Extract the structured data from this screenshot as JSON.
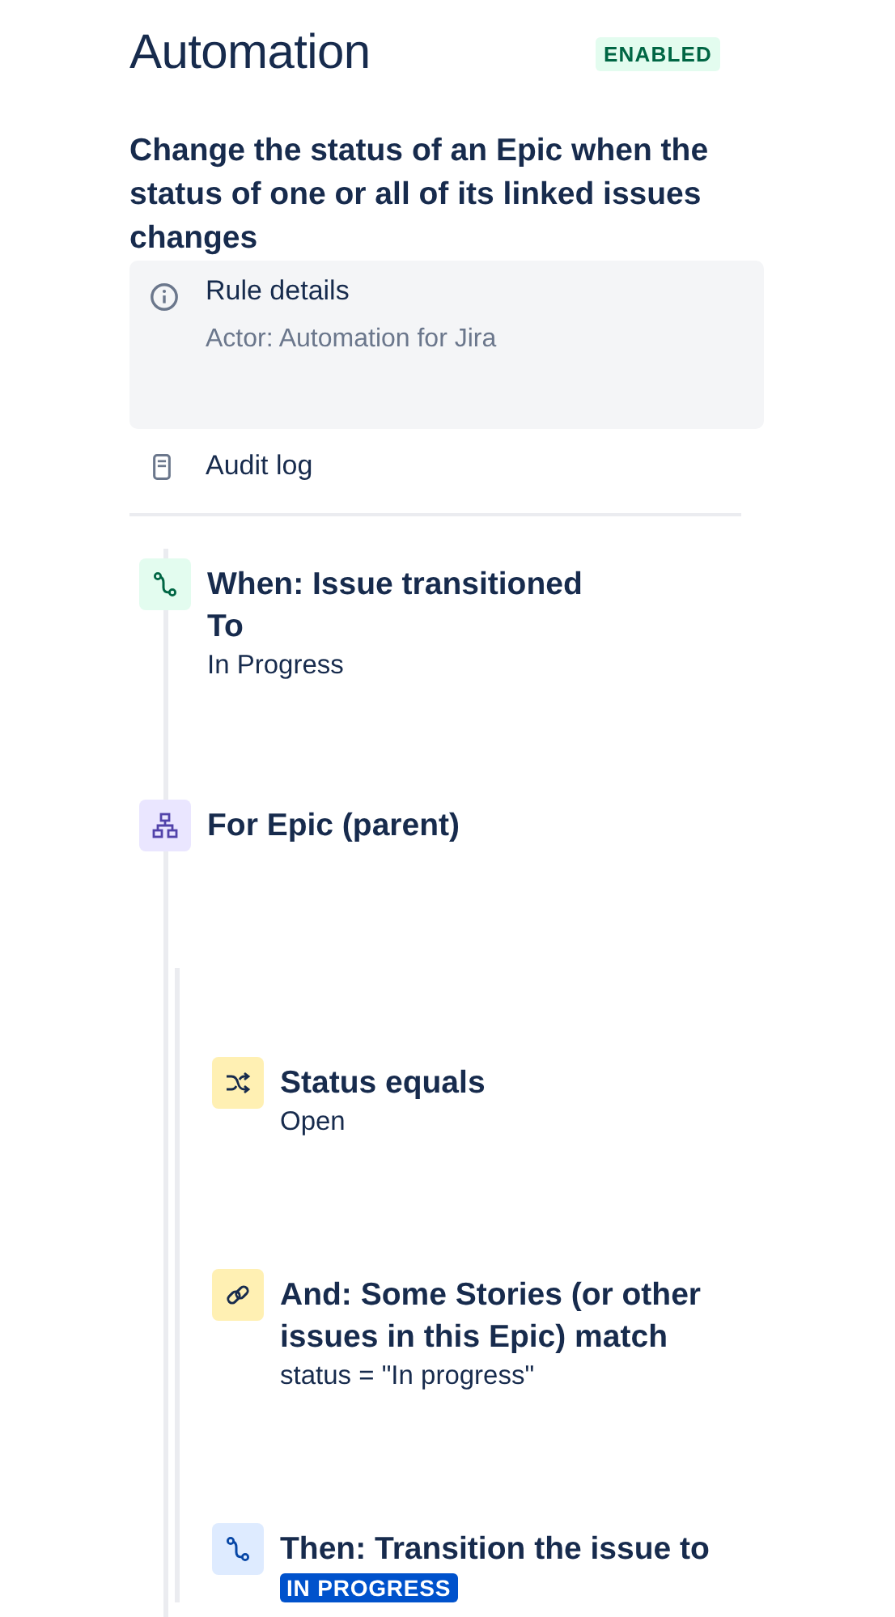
{
  "header": {
    "title": "Automation",
    "status": {
      "label": "ENABLED",
      "enabled": true
    }
  },
  "rule_name": "Change the status of an Epic when the status of one or all of its linked issues changes",
  "rule_details": {
    "title": "Rule details",
    "actor": "Actor: Automation for Jira"
  },
  "audit_log": "Audit log",
  "components": [
    {
      "kind": "trigger",
      "title": "When: Issue transitioned",
      "subtitle": "To",
      "detail": {
        "kind": "text",
        "text": "In Progress"
      }
    },
    {
      "kind": "branch",
      "title": "For Epic (parent)",
      "children": [
        {
          "kind": "condition",
          "title": "Status equals",
          "detail": {
            "kind": "text",
            "text": "Open"
          }
        },
        {
          "kind": "related",
          "title": "And: Some Stories (or other issues in this Epic) match",
          "detail": {
            "kind": "text",
            "text": "status = \"In progress\""
          }
        },
        {
          "kind": "action",
          "title": "Then: Transition the issue to",
          "detail": {
            "kind": "lozenge",
            "text": "IN PROGRESS"
          }
        }
      ]
    }
  ]
}
